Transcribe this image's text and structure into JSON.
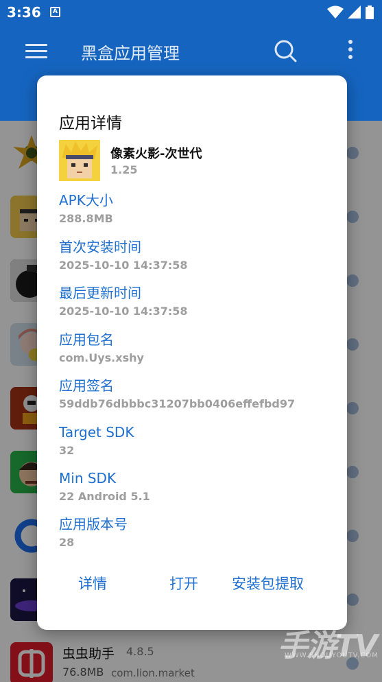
{
  "status_bar": {
    "time": "3:36",
    "notification_glyph": "A"
  },
  "app_bar": {
    "title": "黑盒应用管理"
  },
  "list": {
    "visible_row": {
      "name": "虫虫助手",
      "version": "4.8.5",
      "size": "76.8MB",
      "package": "com.lion.market"
    }
  },
  "dialog": {
    "title": "应用详情",
    "app_name": "像素火影-次世代",
    "app_version": "1.25",
    "fields": [
      {
        "label": "APK大小",
        "value": "288.8MB"
      },
      {
        "label": "首次安装时间",
        "value": "2025-10-10 14:37:58"
      },
      {
        "label": "最后更新时间",
        "value": "2025-10-10 14:37:58"
      },
      {
        "label": "应用包名",
        "value": "com.Uys.xshy"
      },
      {
        "label": "应用签名",
        "value": "59ddb76dbbbc31207bb0406effefbd97"
      },
      {
        "label": "Target SDK",
        "value": "32"
      },
      {
        "label": "Min SDK",
        "value": "22 Android 5.1"
      },
      {
        "label": "应用版本号",
        "value": "28"
      }
    ],
    "actions": {
      "details": "详情",
      "open": "打开",
      "extract": "安装包提取"
    }
  },
  "watermark": {
    "text": "手游TV",
    "sub": "WWW.SHOUYOUTV.COM"
  },
  "colors": {
    "primary": "#1565c0",
    "accent": "#1e6fd0",
    "secondary_text": "#9e9e9e"
  }
}
